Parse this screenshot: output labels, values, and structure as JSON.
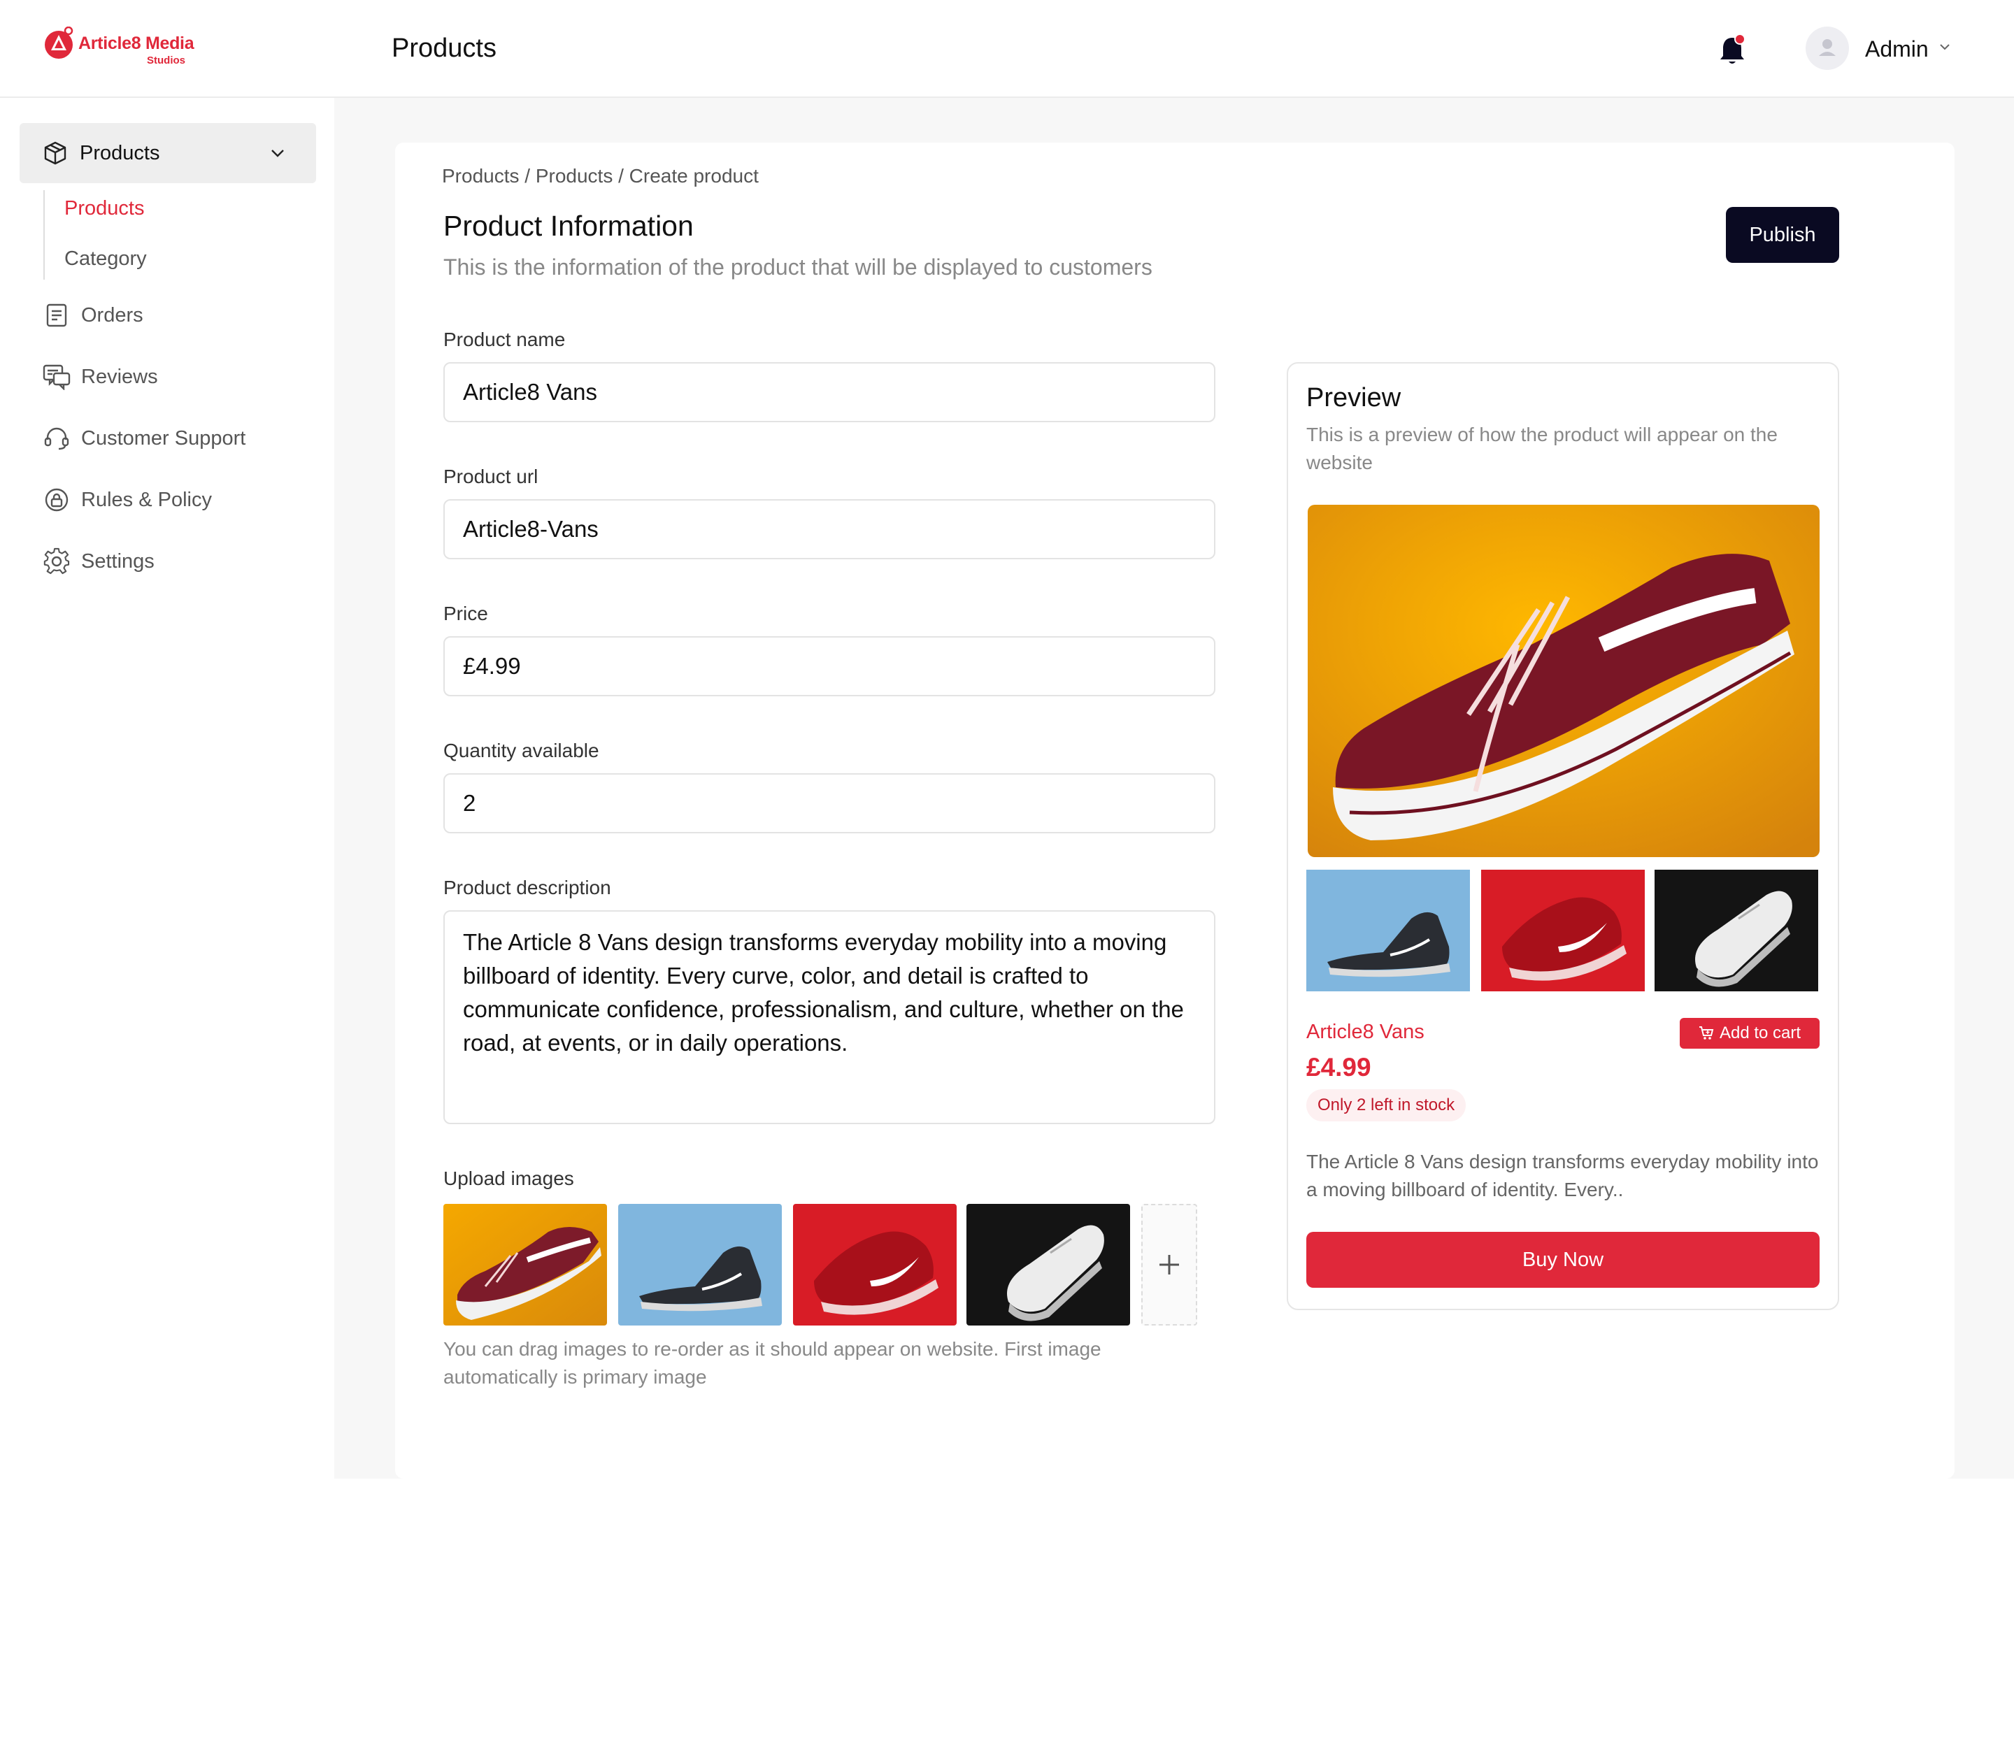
{
  "brand": {
    "name": "Article8 Media",
    "tagline": "Studios",
    "color": "#e0283a"
  },
  "header": {
    "title": "Products",
    "user_name": "Admin"
  },
  "sidebar": {
    "group": {
      "label": "Products",
      "icon": "box-icon"
    },
    "sub_items": [
      {
        "label": "Products",
        "active": true
      },
      {
        "label": "Category",
        "active": false
      }
    ],
    "items": [
      {
        "label": "Orders",
        "icon": "orders-icon"
      },
      {
        "label": "Reviews",
        "icon": "reviews-icon"
      },
      {
        "label": "Customer Support",
        "icon": "headset-icon"
      },
      {
        "label": "Rules & Policy",
        "icon": "lock-icon"
      },
      {
        "label": "Settings",
        "icon": "gear-icon"
      }
    ]
  },
  "breadcrumb": "Products / Products / Create product",
  "form": {
    "title": "Product Information",
    "subtitle": "This is the information of the product that will be displayed to customers",
    "publish_label": "Publish",
    "fields": [
      {
        "label": "Product name",
        "value": "Article8 Vans"
      },
      {
        "label": "Product url",
        "value": "Article8-Vans"
      },
      {
        "label": "Price",
        "value": "£4.99"
      },
      {
        "label": "Quantity available",
        "value": "2"
      }
    ],
    "description_label": "Product description",
    "description_value": "The Article 8 Vans design transforms everyday mobility into a moving billboard of identity. Every curve, color, and detail is crafted to communicate confidence, professionalism, and culture, whether on the road, at events, or in daily operations.",
    "upload_label": "Upload images",
    "upload_hint": "You can drag images to re-order as it should appear on website. First image automatically is primary image"
  },
  "preview": {
    "title": "Preview",
    "subtitle": "This is a preview of how the product will appear on the website",
    "product_name": "Article8 Vans",
    "add_to_cart_label": "Add to cart",
    "price": "£4.99",
    "stock_badge": "Only 2 left in stock",
    "short_description": "The Article 8 Vans design transforms everyday mobility into a moving billboard of identity. Every..",
    "buy_label": "Buy Now"
  },
  "colors": {
    "accent": "#e0283a",
    "publish_bg": "#0a0a22"
  }
}
